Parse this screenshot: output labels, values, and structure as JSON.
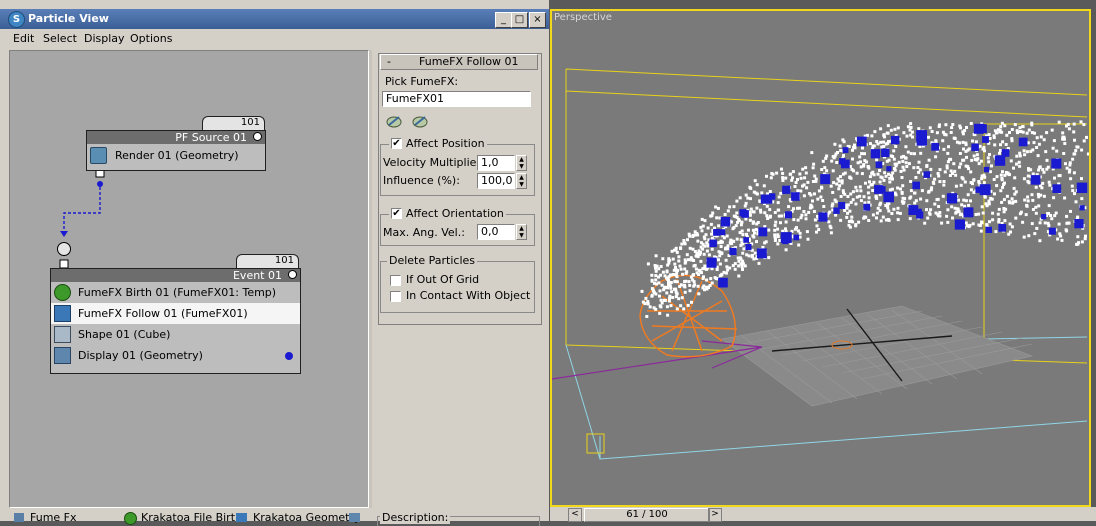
{
  "window": {
    "title": "Particle View",
    "controls": [
      "_",
      "□",
      "×"
    ]
  },
  "menu": [
    "Edit",
    "Select",
    "Display",
    "Options"
  ],
  "pf_source": {
    "count": "101",
    "name": "PF Source 01",
    "operators": [
      {
        "label": "Render 01 (Geometry)",
        "icon": "render-teapot-icon"
      }
    ]
  },
  "event": {
    "count": "101",
    "name": "Event 01",
    "operators": [
      {
        "label": "FumeFX Birth 01 (FumeFX01: Temp)",
        "icon": "fumefx-birth-icon"
      },
      {
        "label": "FumeFX Follow 01 (FumeFX01)",
        "icon": "fumefx-follow-icon"
      },
      {
        "label": "Shape 01 (Cube)",
        "icon": "shape-cube-icon"
      },
      {
        "label": "Display 01 (Geometry)",
        "icon": "display-icon"
      }
    ]
  },
  "panel": {
    "rollout_title": "FumeFX Follow 01",
    "collapse": "-",
    "pick_label": "Pick FumeFX:",
    "pick_value": "FumeFX01",
    "affect_position": {
      "label": "Affect Position",
      "checked": true
    },
    "velocity_multiplier": {
      "label": "Velocity Multiplier:",
      "value": "1,0"
    },
    "influence": {
      "label": "Influence (%):",
      "value": "100,0"
    },
    "affect_orientation": {
      "label": "Affect Orientation",
      "checked": true
    },
    "max_ang_vel": {
      "label": "Max. Ang. Vel.:",
      "value": "0,0"
    },
    "delete_particles": {
      "label": "Delete Particles",
      "if_out_of_grid": "If Out Of Grid",
      "in_contact": "In Contact With Object"
    },
    "description_label": "Description:"
  },
  "depot": [
    "Fume Fx",
    "Krakatoa File Birth",
    "Krakatoa Geometry"
  ],
  "viewport": {
    "label": "Perspective",
    "frame": "61 / 100",
    "prev": "<",
    "next": ">"
  },
  "colors": {
    "accent": "#f0d81a",
    "selection": "#f5f5f5",
    "title_bar": "#3b5e96"
  }
}
